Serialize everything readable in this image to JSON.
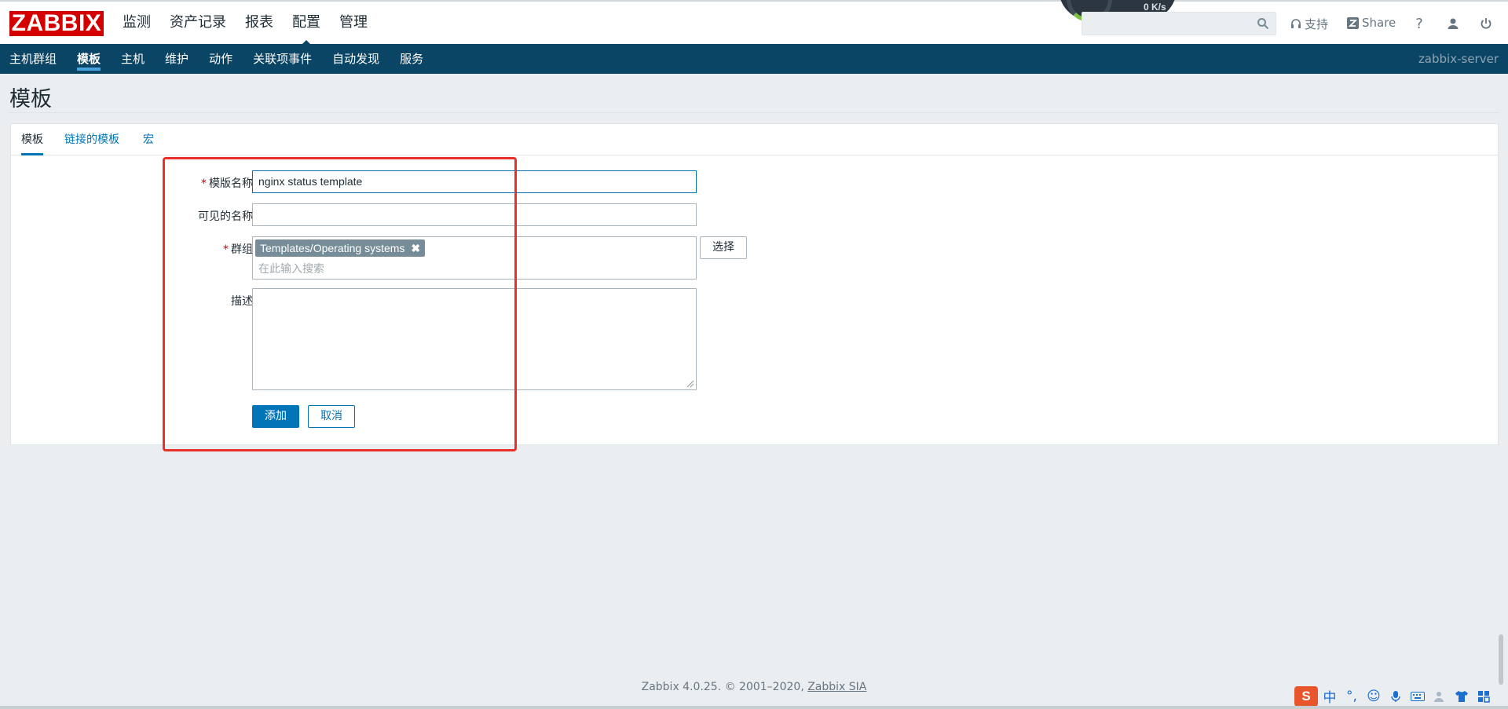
{
  "logo": "ZABBIX",
  "main_menu": [
    "监测",
    "资产记录",
    "报表",
    "配置",
    "管理"
  ],
  "main_menu_active": "配置",
  "gauge_value": "0 K/s",
  "search": {
    "placeholder": "",
    "value": ""
  },
  "tools": {
    "support": "支持",
    "share": "Share",
    "help": "?"
  },
  "sub_menu": [
    "主机群组",
    "模板",
    "主机",
    "维护",
    "动作",
    "关联项事件",
    "自动发现",
    "服务"
  ],
  "sub_menu_active": "模板",
  "server_name": "zabbix-server",
  "page_title": "模板",
  "tabs": [
    "模板",
    "链接的模板",
    "宏"
  ],
  "form": {
    "template_name_label": "模版名称",
    "template_name_value": "nginx status template",
    "visible_name_label": "可见的名称",
    "visible_name_value": "",
    "groups_label": "群组",
    "group_chip": "Templates/Operating systems",
    "group_search_placeholder": "在此输入搜索",
    "select_button": "选择",
    "description_label": "描述",
    "description_value": "",
    "add_button": "添加",
    "cancel_button": "取消"
  },
  "footer": {
    "text": "Zabbix 4.0.25. © 2001–2020, ",
    "link": "Zabbix SIA"
  },
  "tray": {
    "sogou": "S",
    "ime_mode": "中"
  },
  "colors": {
    "brand_red": "#d40000",
    "nav_blue": "#0b4566",
    "accent": "#0275b8",
    "annotation_red": "#e8302a"
  }
}
